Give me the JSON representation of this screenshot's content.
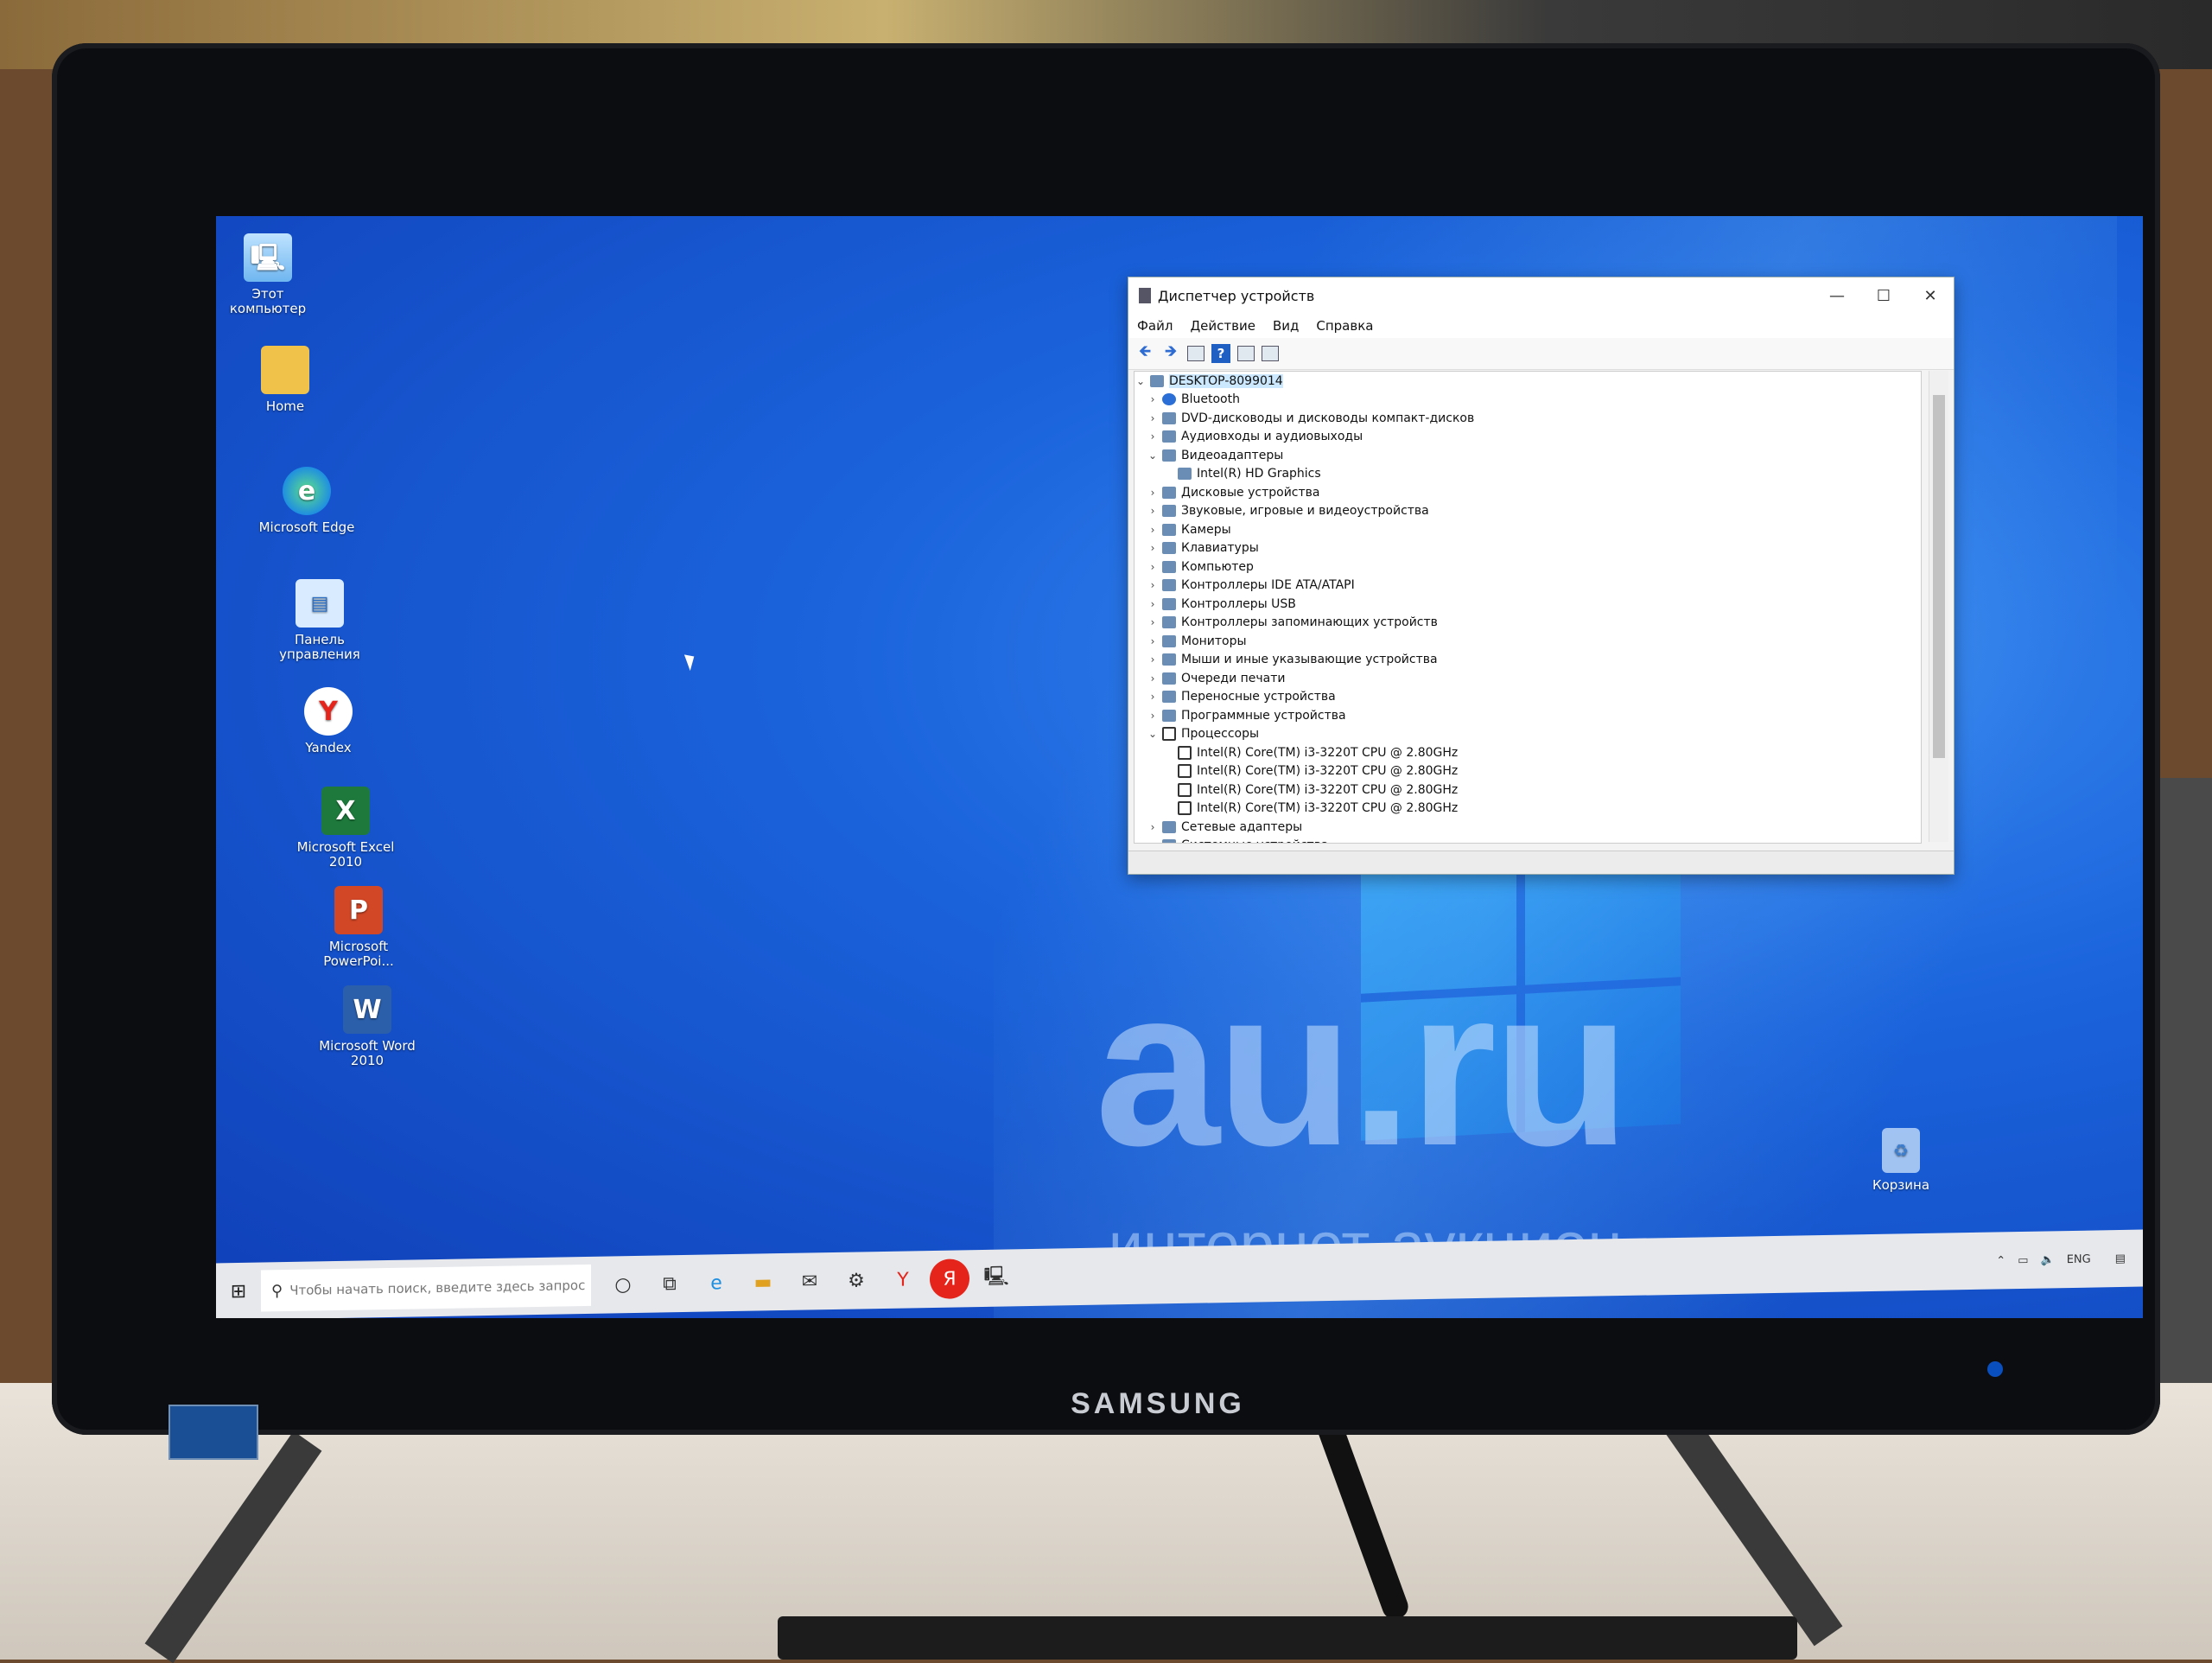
{
  "monitor_brand": "SAMSUNG",
  "desktop_icons": [
    {
      "label": "Этот компьютер",
      "icon": "computer-icon"
    },
    {
      "label": "Home",
      "icon": "folder-icon"
    },
    {
      "label": "Microsoft Edge",
      "icon": "edge-icon"
    },
    {
      "label": "Панель управления",
      "icon": "control-panel-icon"
    },
    {
      "label": "Yandex",
      "icon": "yandex-icon"
    },
    {
      "label": "Microsoft Excel 2010",
      "icon": "excel-icon"
    },
    {
      "label": "Microsoft PowerPoi...",
      "icon": "powerpoint-icon"
    },
    {
      "label": "Microsoft Word 2010",
      "icon": "word-icon"
    },
    {
      "label": "Корзина",
      "icon": "recycle-bin-icon"
    }
  ],
  "watermark": {
    "main": "au.ru",
    "sub": "интернет-аукцион"
  },
  "device_manager": {
    "title": "Диспетчер устройств",
    "controls": {
      "minimize": "—",
      "maximize": "☐",
      "close": "✕"
    },
    "menu": [
      "Файл",
      "Действие",
      "Вид",
      "Справка"
    ],
    "root": "DESKTOP-8099014",
    "tree": [
      {
        "label": "Bluetooth",
        "expanded": false,
        "children": []
      },
      {
        "label": "DVD-дисководы и дисководы компакт-дисков",
        "expanded": false,
        "children": []
      },
      {
        "label": "Аудиовходы и аудиовыходы",
        "expanded": false,
        "children": []
      },
      {
        "label": "Видеоадаптеры",
        "expanded": true,
        "children": [
          "Intel(R) HD Graphics"
        ]
      },
      {
        "label": "Дисковые устройства",
        "expanded": false,
        "children": []
      },
      {
        "label": "Звуковые, игровые и видеоустройства",
        "expanded": false,
        "children": []
      },
      {
        "label": "Камеры",
        "expanded": false,
        "children": []
      },
      {
        "label": "Клавиатуры",
        "expanded": false,
        "children": []
      },
      {
        "label": "Компьютер",
        "expanded": false,
        "children": []
      },
      {
        "label": "Контроллеры IDE ATA/ATAPI",
        "expanded": false,
        "children": []
      },
      {
        "label": "Контроллеры USB",
        "expanded": false,
        "children": []
      },
      {
        "label": "Контроллеры запоминающих устройств",
        "expanded": false,
        "children": []
      },
      {
        "label": "Мониторы",
        "expanded": false,
        "children": []
      },
      {
        "label": "Мыши и иные указывающие устройства",
        "expanded": false,
        "children": []
      },
      {
        "label": "Очереди печати",
        "expanded": false,
        "children": []
      },
      {
        "label": "Переносные устройства",
        "expanded": false,
        "children": []
      },
      {
        "label": "Программные устройства",
        "expanded": false,
        "children": []
      },
      {
        "label": "Процессоры",
        "expanded": true,
        "children": [
          "Intel(R) Core(TM) i3-3220T CPU @ 2.80GHz",
          "Intel(R) Core(TM) i3-3220T CPU @ 2.80GHz",
          "Intel(R) Core(TM) i3-3220T CPU @ 2.80GHz",
          "Intel(R) Core(TM) i3-3220T CPU @ 2.80GHz"
        ]
      },
      {
        "label": "Сетевые адаптеры",
        "expanded": false,
        "children": []
      },
      {
        "label": "Системные устройства",
        "expanded": false,
        "children": []
      }
    ]
  },
  "taskbar": {
    "search_placeholder": "Чтобы начать поиск, введите здесь запрос",
    "pinned": [
      "cortana-icon",
      "task-view-icon",
      "edge-icon",
      "explorer-icon",
      "mail-icon",
      "settings-icon",
      "yandex-browser-icon",
      "yandex-icon",
      "device-manager-icon"
    ],
    "language": "ENG"
  }
}
